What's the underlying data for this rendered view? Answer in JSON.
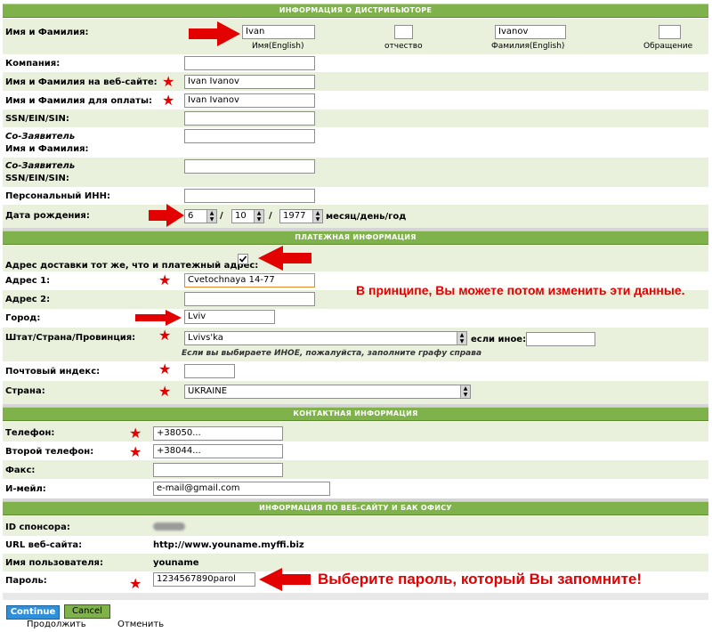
{
  "sections": {
    "distributor": "ИНФОРМАЦИЯ О ДИСТРИБЬЮТОРЕ",
    "payment": "ПЛАТЕЖНАЯ ИНФОРМАЦИЯ",
    "contact": "КОНТАКТНАЯ ИНФОРМАЦИЯ",
    "website": "ИНФОРМАЦИЯ ПО ВЕБ-САЙТУ И БАК ОФИСУ"
  },
  "distributor": {
    "name_label": "Имя и Фамилия:",
    "first_name": "Ivan",
    "first_name_sub": "Имя(English)",
    "patronymic": "",
    "patronymic_sub": "отчество",
    "last_name": "Ivanov",
    "last_name_sub": "Фамилия(English)",
    "title": "",
    "title_sub": "Обращение",
    "company_label": "Компания:",
    "company": "",
    "website_name_label": "Имя и Фамилия на веб-сайте:",
    "website_name": "Ivan Ivanov",
    "payment_name_label": "Имя и Фамилия для оплаты:",
    "payment_name": "Ivan Ivanov",
    "ssn_label": "SSN/EIN/SIN:",
    "ssn": "",
    "coapp_name_label1": "Со-Заявитель",
    "coapp_name_label2": "Имя и Фамилия:",
    "coapp_name": "",
    "coapp_ssn_label1": "Со-Заявитель",
    "coapp_ssn_label2": "SSN/EIN/SIN:",
    "coapp_ssn": "",
    "inn_label": "Персональный ИНН:",
    "inn": "",
    "dob_label": "Дата рождения:",
    "dob_month": "6",
    "dob_day": "10",
    "dob_year": "1977",
    "dob_sep": "/",
    "dob_format": "месяц/день/год"
  },
  "payment": {
    "same_address_label": "Адрес доставки тот же, что и платежный адрес:",
    "same_address_checked": true,
    "address1_label": "Адрес 1:",
    "address1": "Cvetochnaya 14-77",
    "address2_label": "Адрес 2:",
    "address2": "",
    "city_label": "Город:",
    "city": "Lviv",
    "state_label": "Штат/Страна/Провинция:",
    "state": "Lvivs'ka",
    "other_label": "если иное:",
    "other": "",
    "other_hint": "Если вы выбираете ИНОЕ, пожалуйста, заполните графу справа",
    "zip_label": "Почтовый индекс:",
    "zip": "",
    "country_label": "Страна:",
    "country": "UKRAINE"
  },
  "contact": {
    "phone_label": "Телефон:",
    "phone": "+38050...",
    "phone2_label": "Второй телефон:",
    "phone2": "+38044...",
    "fax_label": "Факс:",
    "fax": "",
    "email_label": "И-мейл:",
    "email": "e-mail@gmail.com"
  },
  "website": {
    "sponsor_label": "ID спонсора:",
    "url_label": "URL веб-сайта:",
    "url": "http://www.youname.myffi.biz",
    "username_label": "Имя пользователя:",
    "username": "youname",
    "password_label": "Пароль:",
    "password": "1234567890parol"
  },
  "annotations": {
    "change_note": "В принципе, Вы можете потом изменить эти данные.",
    "password_note": "Выберите пароль, который Вы запомните!",
    "star": "★"
  },
  "buttons": {
    "continue": "Continue",
    "cancel": "Cancel",
    "continue_caption": "Продолжить",
    "cancel_caption": "Отменить"
  },
  "colors": {
    "header_green": "#7fb24b",
    "row_green": "#e9f1dc",
    "annotation_red": "#e20000",
    "continue_blue": "#2f8fd8",
    "cancel_green": "#7fb24b"
  }
}
